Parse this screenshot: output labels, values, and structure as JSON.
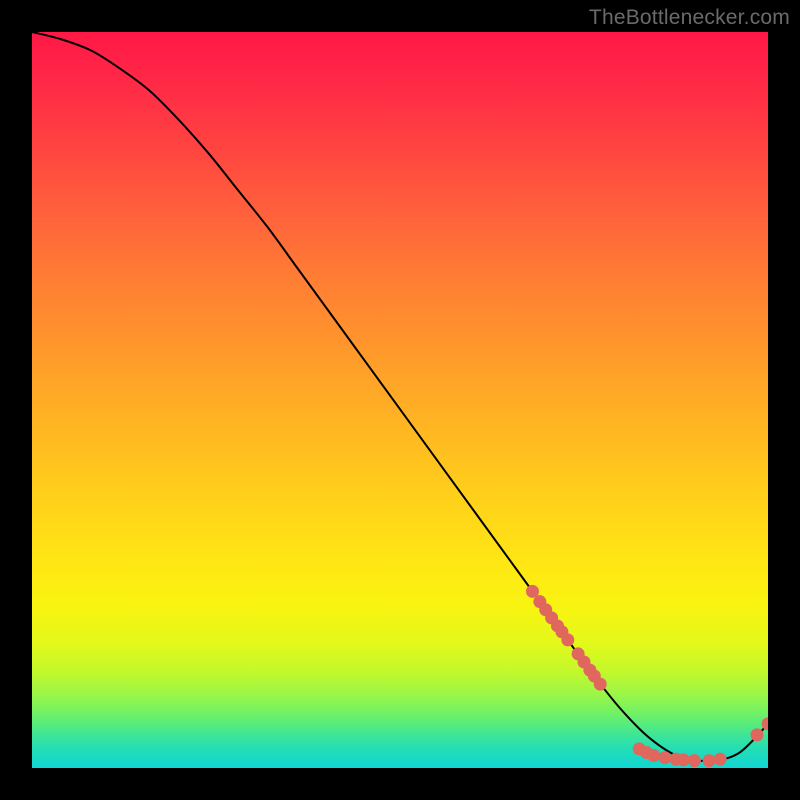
{
  "watermark": "TheBottlenecker.com",
  "chart_data": {
    "type": "line",
    "title": "",
    "xlabel": "",
    "ylabel": "",
    "xlim": [
      0,
      100
    ],
    "ylim": [
      0,
      100
    ],
    "series": [
      {
        "name": "curve",
        "x": [
          0,
          4,
          8,
          12,
          16,
          20,
          24,
          28,
          32,
          36,
          40,
          44,
          48,
          52,
          56,
          60,
          64,
          68,
          72,
          76,
          80,
          84,
          88,
          92,
          96,
          100
        ],
        "y": [
          100,
          99,
          97.5,
          95,
          92,
          88,
          83.5,
          78.5,
          73.5,
          68,
          62.5,
          57,
          51.5,
          46,
          40.5,
          35,
          29.5,
          24,
          18.5,
          13,
          8,
          4,
          1.5,
          1,
          2,
          6
        ]
      }
    ],
    "markers": [
      {
        "x": 68.0,
        "y": 24.0
      },
      {
        "x": 69.0,
        "y": 22.6
      },
      {
        "x": 69.8,
        "y": 21.5
      },
      {
        "x": 70.6,
        "y": 20.4
      },
      {
        "x": 71.4,
        "y": 19.3
      },
      {
        "x": 72.0,
        "y": 18.5
      },
      {
        "x": 72.8,
        "y": 17.4
      },
      {
        "x": 74.2,
        "y": 15.5
      },
      {
        "x": 75.0,
        "y": 14.4
      },
      {
        "x": 75.8,
        "y": 13.3
      },
      {
        "x": 76.4,
        "y": 12.5
      },
      {
        "x": 77.2,
        "y": 11.4
      },
      {
        "x": 82.5,
        "y": 2.6
      },
      {
        "x": 83.5,
        "y": 2.1
      },
      {
        "x": 84.5,
        "y": 1.7
      },
      {
        "x": 86.0,
        "y": 1.4
      },
      {
        "x": 87.5,
        "y": 1.2
      },
      {
        "x": 88.5,
        "y": 1.1
      },
      {
        "x": 90.0,
        "y": 1.0
      },
      {
        "x": 92.0,
        "y": 1.0
      },
      {
        "x": 93.5,
        "y": 1.2
      },
      {
        "x": 98.5,
        "y": 4.5
      },
      {
        "x": 100.0,
        "y": 6.0
      }
    ],
    "marker_color": "#e0675e",
    "curve_color": "#000000"
  }
}
